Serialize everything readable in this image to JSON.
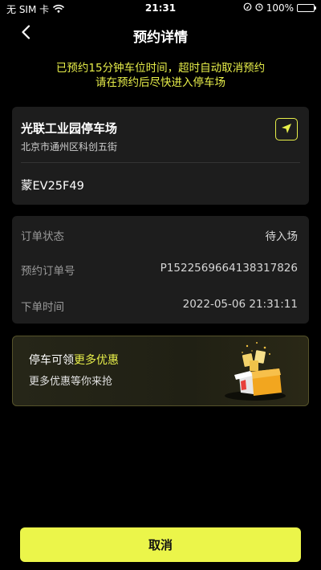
{
  "status_bar": {
    "carrier": "无 SIM 卡",
    "time": "21:31",
    "battery": "100%",
    "battery_level": 1.0
  },
  "header": {
    "title": "预约详情"
  },
  "notice": {
    "line1": "已预约15分钟车位时间，超时自动取消预约",
    "line2": "请在预约后尽快进入停车场"
  },
  "parking": {
    "name": "光联工业园停车场",
    "address": "北京市通州区科创五街",
    "plate": "蒙EV25F49"
  },
  "order": {
    "rows": [
      {
        "label": "订单状态",
        "value": "待入场"
      },
      {
        "label": "预约订单号",
        "value": "P1522569664138317826"
      },
      {
        "label": "下单时间",
        "value": "2022-05-06 21:31:11"
      }
    ]
  },
  "promo": {
    "title_prefix": "停车可领",
    "title_highlight": "更多优惠",
    "subtitle": "更多优惠等你来抢"
  },
  "actions": {
    "cancel_label": "取消"
  },
  "colors": {
    "accent": "#ebf54a",
    "notice": "#e8ef4a",
    "card_bg": "#1d1d1d",
    "page_bg": "#000000"
  },
  "icons": {
    "back": "chevron-left-icon",
    "navigate": "navigation-arrow-icon",
    "gift": "gift-box-icon"
  }
}
